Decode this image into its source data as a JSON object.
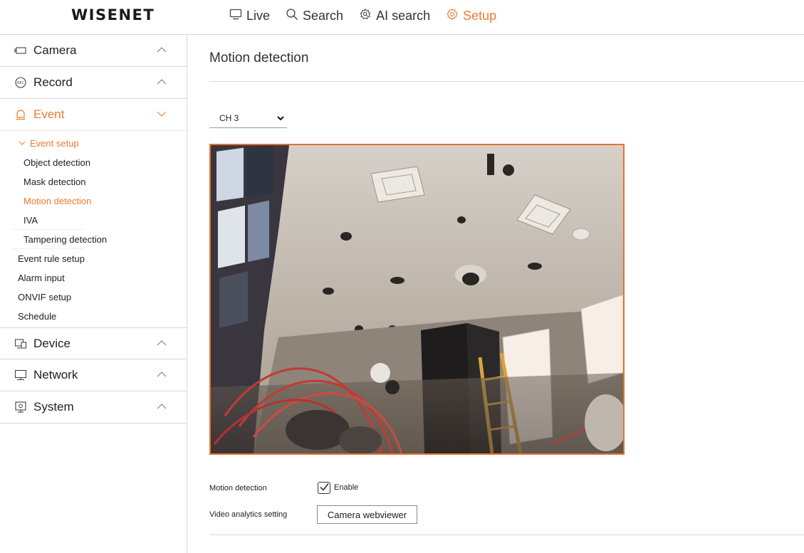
{
  "header": {
    "logo": "WISENET",
    "nav": [
      {
        "label": "Live",
        "icon": "monitor-icon"
      },
      {
        "label": "Search",
        "icon": "search-icon"
      },
      {
        "label": "AI search",
        "icon": "ai-search-icon"
      },
      {
        "label": "Setup",
        "icon": "gear-icon",
        "active": true
      }
    ]
  },
  "sidebar": {
    "menus": [
      {
        "label": "Camera",
        "icon": "camera-icon"
      },
      {
        "label": "Record",
        "icon": "rec-icon"
      },
      {
        "label": "Event",
        "icon": "bell-icon",
        "active": true
      },
      {
        "label": "Device",
        "icon": "device-icon"
      },
      {
        "label": "Network",
        "icon": "network-icon"
      },
      {
        "label": "System",
        "icon": "system-icon"
      }
    ],
    "event_sub": {
      "title": "Event setup",
      "items": [
        "Object detection",
        "Mask detection",
        "Motion detection",
        "IVA",
        "Tampering detection"
      ],
      "others": [
        "Event rule setup",
        "Alarm input",
        "ONVIF setup",
        "Schedule"
      ]
    }
  },
  "main": {
    "title": "Motion detection",
    "channel": "CH 3",
    "motion_label": "Motion detection",
    "enable_label": "Enable",
    "enable_checked": true,
    "analytics_label": "Video analytics setting",
    "webviewer_button": "Camera webviewer"
  },
  "colors": {
    "accent": "#ee7b30",
    "border": "#d6d6d6",
    "video_border": "#e8702f"
  }
}
